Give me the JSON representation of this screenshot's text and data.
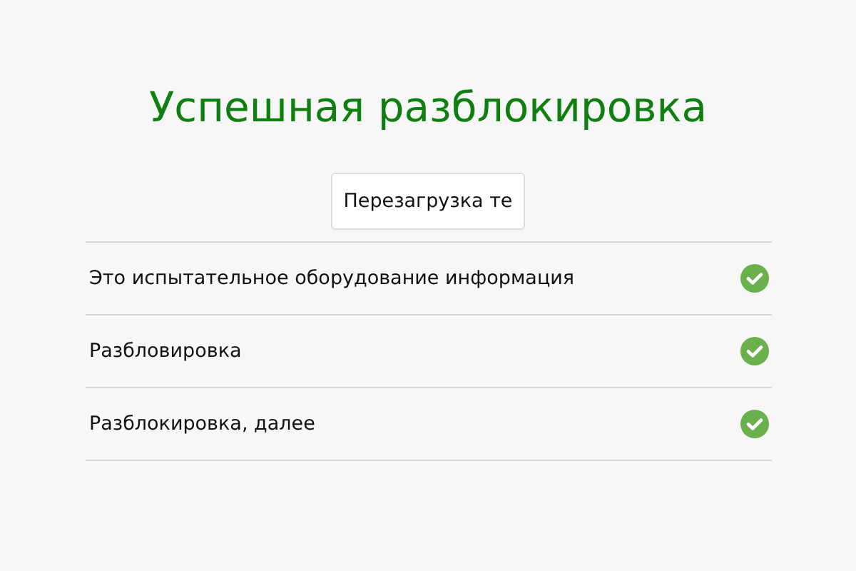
{
  "title": "Успешная разблокировка",
  "button": {
    "label": "Перезагрузка те"
  },
  "steps": [
    {
      "label": "Это испытательное оборудование информация",
      "done": true
    },
    {
      "label": "Разбловировка",
      "done": true
    },
    {
      "label": "Разблокировка, далее",
      "done": true
    }
  ]
}
